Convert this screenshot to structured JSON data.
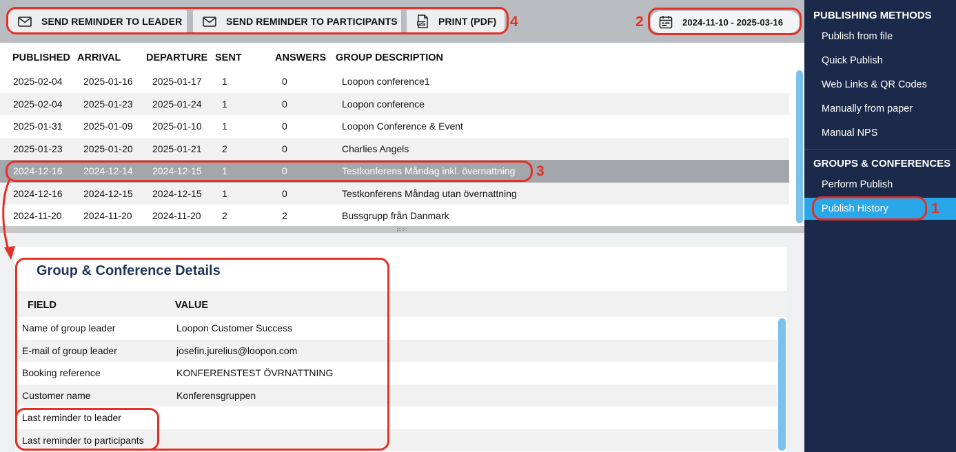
{
  "toolbar": {
    "send_leader": "SEND REMINDER TO LEADER",
    "send_participants": "SEND REMINDER TO PARTICIPANTS",
    "print_pdf": "PRINT (PDF)",
    "date_range": "2024-11-10 - 2025-03-16"
  },
  "annotations": {
    "n1": "1",
    "n2": "2",
    "n3": "3",
    "n4": "4"
  },
  "publish_table": {
    "columns": [
      "PUBLISHED",
      "ARRIVAL",
      "DEPARTURE",
      "SENT",
      "ANSWERS",
      "GROUP DESCRIPTION"
    ],
    "rows": [
      [
        "2025-02-04",
        "2025-01-16",
        "2025-01-17",
        "1",
        "0",
        "Loopon conference1"
      ],
      [
        "2025-02-04",
        "2025-01-23",
        "2025-01-24",
        "1",
        "0",
        "Loopon conference"
      ],
      [
        "2025-01-31",
        "2025-01-09",
        "2025-01-10",
        "1",
        "0",
        "Loopon Conference & Event"
      ],
      [
        "2025-01-23",
        "2025-01-20",
        "2025-01-21",
        "2",
        "0",
        "Charlies Angels"
      ],
      [
        "2024-12-16",
        "2024-12-14",
        "2024-12-15",
        "1",
        "0",
        "Testkonferens Måndag inkl. övernattning"
      ],
      [
        "2024-12-16",
        "2024-12-15",
        "2024-12-15",
        "1",
        "0",
        "Testkonferens Måndag utan övernattning"
      ],
      [
        "2024-11-20",
        "2024-11-20",
        "2024-11-20",
        "2",
        "2",
        "Bussgrupp från Danmark"
      ]
    ]
  },
  "details": {
    "title": "Group & Conference Details",
    "col_field": "FIELD",
    "col_value": "VALUE",
    "rows": [
      [
        "Name of group leader",
        "Loopon Customer Success"
      ],
      [
        "E-mail of group leader",
        "josefin.jurelius@loopon.com"
      ],
      [
        "Booking reference",
        "KONFERENSTEST ÖVRNATTNING"
      ],
      [
        "Customer name",
        "Konferensgruppen"
      ],
      [
        "Last reminder to leader",
        ""
      ],
      [
        "Last reminder to participants",
        ""
      ]
    ]
  },
  "sidebar": {
    "section1": "PUBLISHING METHODS",
    "items1": [
      "Publish from file",
      "Quick Publish",
      "Web Links & QR Codes",
      "Manually from paper",
      "Manual NPS"
    ],
    "section2": "GROUPS & CONFERENCES",
    "items2": [
      "Perform Publish",
      "Publish History"
    ]
  },
  "colors": {
    "sidebar_bg": "#1b2a4a",
    "active_item": "#2aa7e8",
    "annotation": "#e53026",
    "selected_row": "#a3a6ab",
    "title_text": "#1f3558"
  }
}
